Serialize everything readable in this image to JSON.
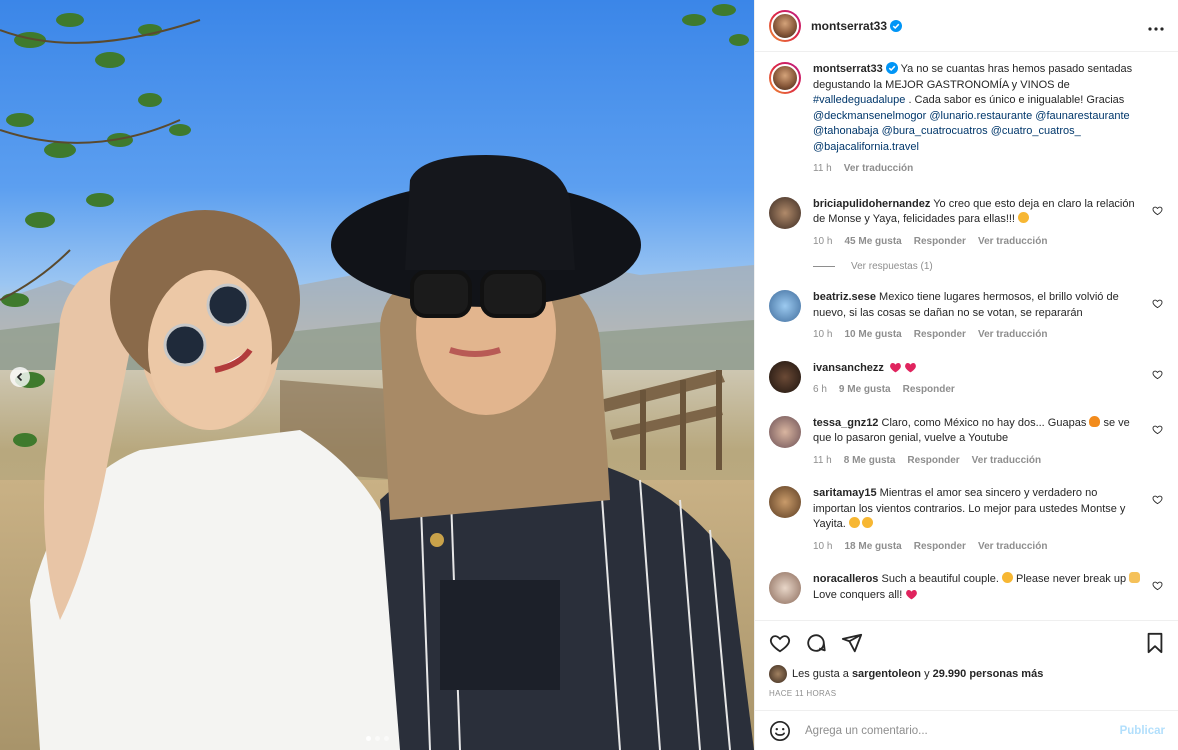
{
  "post": {
    "username": "montserrat33",
    "caption_text": "Ya no se cuantas hras hemos pasado sentadas degustando la MEJOR GASTRONOMÍA y VINOS de",
    "hashtag": "#valledeguadalupe",
    "caption_text2": ". Cada sabor es único e inigualable! Gracias",
    "mentions": [
      "@deckmansenelmogor",
      "@lunario.restaurante",
      "@faunarestaurante",
      "@tahonabaja",
      "@bura_cuatrocuatros",
      "@cuatro_cuatros_",
      "@bajacalifornia.travel"
    ],
    "time": "11 h",
    "translate": "Ver traducción"
  },
  "comments": [
    {
      "user": "briciapulidohernandez",
      "text": "Yo creo que esto deja en claro la relación de Monse y Yaya, felicidades para ellas!!!",
      "time": "10 h",
      "likes": "45 Me gusta",
      "reply": "Responder",
      "translate": "Ver traducción",
      "view_replies": "Ver respuestas (1)"
    },
    {
      "user": "beatriz.sese",
      "text": "Mexico tiene lugares hermosos, el brillo volvió de nuevo, si las cosas se dañan no se votan, se repararán",
      "time": "10 h",
      "likes": "10 Me gusta",
      "reply": "Responder",
      "translate": "Ver traducción"
    },
    {
      "user": "ivansanchezz",
      "text": "",
      "time": "6 h",
      "likes": "9 Me gusta",
      "reply": "Responder"
    },
    {
      "user": "tessa_gnz12",
      "text": "Claro, como México no hay dos... Guapas",
      "text2": "se ve que lo pasaron genial, vuelve a Youtube",
      "time": "11 h",
      "likes": "8 Me gusta",
      "reply": "Responder",
      "translate": "Ver traducción"
    },
    {
      "user": "saritamay15",
      "text": "Mientras el amor sea sincero y verdadero no importan los vientos contrarios. Lo mejor para ustedes Montse y Yayita.",
      "time": "10 h",
      "likes": "18 Me gusta",
      "reply": "Responder",
      "translate": "Ver traducción"
    },
    {
      "user": "noracalleros",
      "text": "Such a beautiful couple.",
      "text2": "Please never break up",
      "text3": "Love conquers all!"
    }
  ],
  "likes_bar": {
    "prefix": "Les gusta a",
    "user": "sargentoleon",
    "middle": "y",
    "count": "29.990 personas más",
    "time_ago": "HACE 11 HORAS"
  },
  "add_comment": {
    "placeholder": "Agrega un comentario...",
    "publish": "Publicar"
  },
  "colors": {
    "link": "#00376b",
    "muted": "#8e8e8e",
    "verified": "#0095f6",
    "heart_red": "#ed4956"
  },
  "icons": [
    "verified-icon",
    "more-icon",
    "heart-icon",
    "comment-icon",
    "share-icon",
    "bookmark-icon",
    "emoji-icon",
    "carousel-prev-icon"
  ]
}
